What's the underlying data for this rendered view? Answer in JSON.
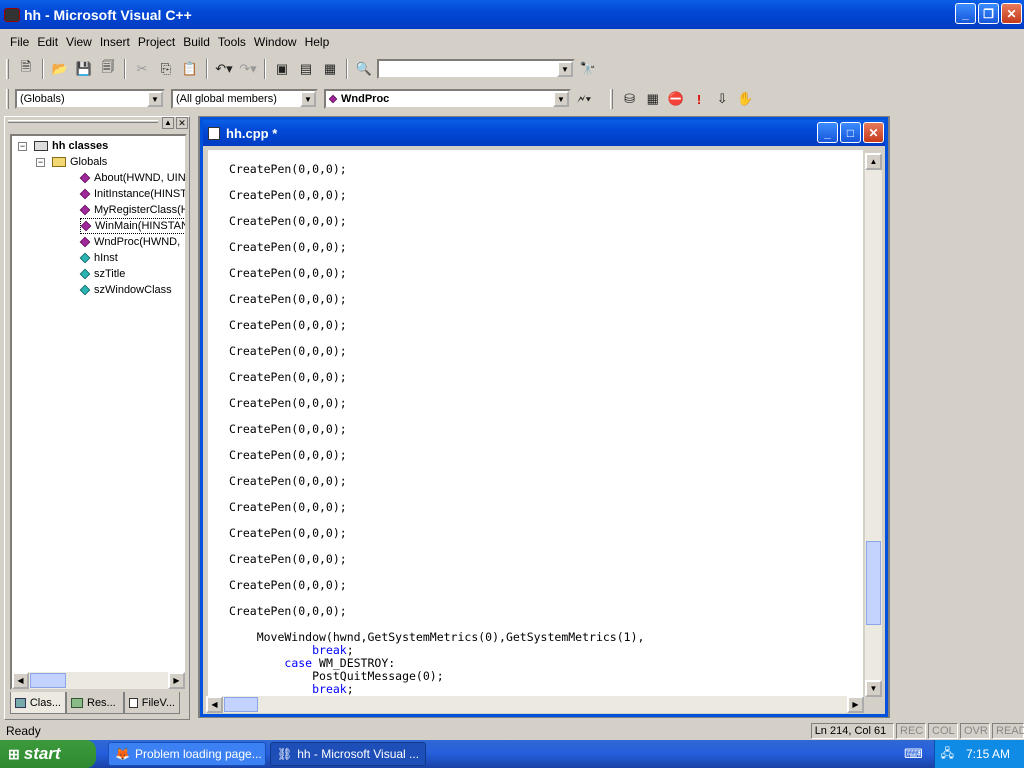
{
  "window": {
    "title": "hh - Microsoft Visual C++"
  },
  "menu": [
    "File",
    "Edit",
    "View",
    "Insert",
    "Project",
    "Build",
    "Tools",
    "Window",
    "Help"
  ],
  "wizard_bar": {
    "class_combo": "(Globals)",
    "filter_combo": "(All global members)",
    "member_combo": "WndProc"
  },
  "class_view": {
    "root": "hh classes",
    "folder": "Globals",
    "items": [
      {
        "label": "About(HWND, UIN",
        "icon": "function-icon"
      },
      {
        "label": "InitInstance(HINST",
        "icon": "function-icon"
      },
      {
        "label": "MyRegisterClass(H",
        "icon": "function-icon"
      },
      {
        "label": "WinMain(HINSTAN",
        "icon": "function-icon"
      },
      {
        "label": "WndProc(HWND,",
        "icon": "function-icon"
      },
      {
        "label": "hInst",
        "icon": "variable-icon"
      },
      {
        "label": "szTitle",
        "icon": "variable-icon"
      },
      {
        "label": "szWindowClass",
        "icon": "variable-icon"
      }
    ],
    "tabs": [
      "Clas...",
      "Res...",
      "FileV..."
    ]
  },
  "editor": {
    "title": "hh.cpp *",
    "lines": [
      "CreatePen(0,0,0);",
      "CreatePen(0,0,0);",
      "CreatePen(0,0,0);",
      "CreatePen(0,0,0);",
      "CreatePen(0,0,0);",
      "CreatePen(0,0,0);",
      "CreatePen(0,0,0);",
      "CreatePen(0,0,0);",
      "CreatePen(0,0,0);",
      "CreatePen(0,0,0);",
      "CreatePen(0,0,0);",
      "CreatePen(0,0,0);",
      "CreatePen(0,0,0);",
      "CreatePen(0,0,0);",
      "CreatePen(0,0,0);",
      "CreatePen(0,0,0);",
      "CreatePen(0,0,0);",
      "CreatePen(0,0,0);"
    ],
    "tail": [
      {
        "text": "    MoveWindow(hwnd,GetSystemMetrics(0),GetSystemMetrics(1),",
        "keyword": false
      },
      {
        "text": "            break;",
        "keyword": true
      },
      {
        "text": "        case WM_DESTROY:",
        "keyword": true
      },
      {
        "text": "            PostQuitMessage(0);",
        "keyword": false
      },
      {
        "text": "            break;",
        "keyword": true
      }
    ],
    "keyword_color": "#0000ff"
  },
  "status": {
    "text": "Ready",
    "position": "Ln 214, Col 61",
    "indicators": [
      "REC",
      "COL",
      "OVR",
      "READ"
    ]
  },
  "taskbar": {
    "start": "start",
    "tasks": [
      "Problem loading page...",
      "hh - Microsoft Visual ..."
    ],
    "clock": "7:15 AM"
  }
}
